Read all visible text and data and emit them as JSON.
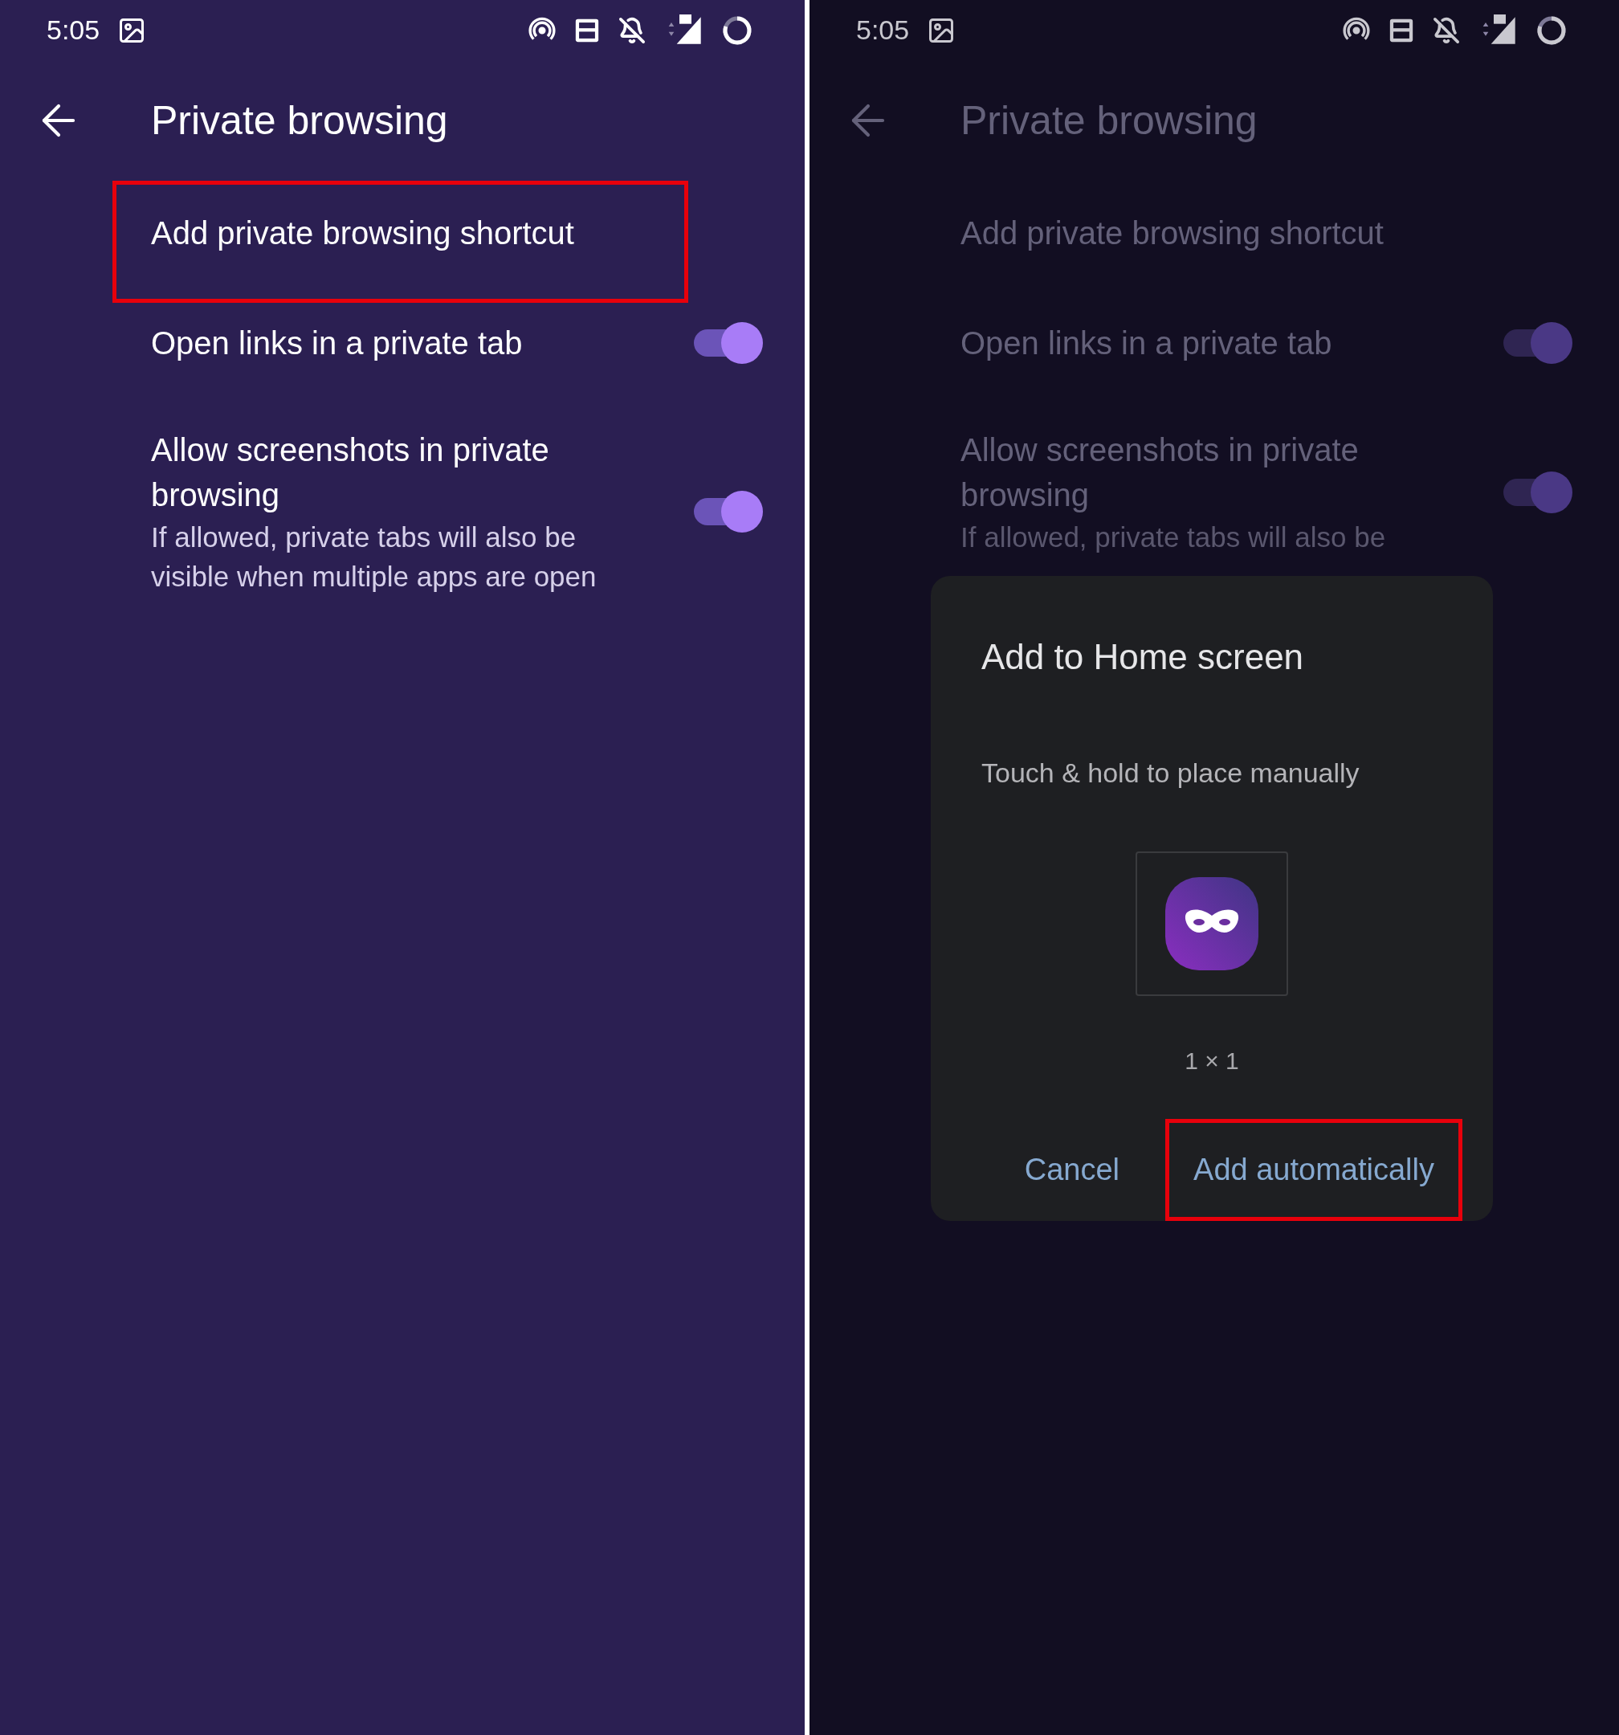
{
  "screens": [
    {
      "dimmed": false,
      "status_bar": {
        "time": "5:05"
      },
      "title": "Private browsing",
      "items": [
        {
          "kind": "action",
          "label": "Add private browsing shortcut",
          "highlighted": true
        },
        {
          "kind": "toggle",
          "label": "Open links in a private tab",
          "on": true,
          "highlighted": false
        },
        {
          "kind": "toggle",
          "label": "Allow screenshots in private browsing",
          "description": "If allowed, private tabs will also be visible when multiple apps are open",
          "on": true,
          "highlighted": false
        }
      ]
    },
    {
      "dimmed": true,
      "status_bar": {
        "time": "5:05"
      },
      "title": "Private browsing",
      "items": [
        {
          "kind": "action",
          "label": "Add private browsing shortcut",
          "highlighted": false
        },
        {
          "kind": "toggle",
          "label": "Open links in a private tab",
          "on": true,
          "highlighted": false
        },
        {
          "kind": "toggle",
          "label": "Allow screenshots in private browsing",
          "description": "If allowed, private tabs will also be",
          "on": true,
          "highlighted": false
        }
      ],
      "dialog": {
        "title": "Add to Home screen",
        "subtitle": "Touch & hold to place manually",
        "size": "1 × 1",
        "buttons": [
          {
            "label": "Cancel",
            "highlighted": false
          },
          {
            "label": "Add automatically",
            "highlighted": true
          }
        ]
      }
    }
  ]
}
